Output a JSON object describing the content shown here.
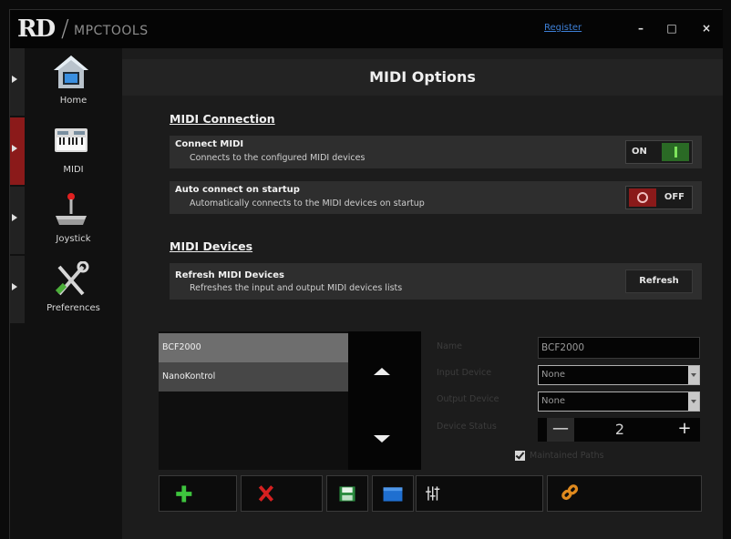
{
  "app": {
    "logo_text": "MPCTOOLS",
    "logo_mark": "RD",
    "register_label": "Register",
    "minimize_label": "–",
    "maximize_label": "□",
    "close_label": "×"
  },
  "sidebar": {
    "items": [
      {
        "label": "Home",
        "icon": "home-icon",
        "active": false
      },
      {
        "label": "MIDI",
        "icon": "midi-keyboard-icon",
        "active": true
      },
      {
        "label": "Joystick",
        "icon": "joystick-icon",
        "active": false
      },
      {
        "label": "Preferences",
        "icon": "tools-icon",
        "active": false
      }
    ]
  },
  "main": {
    "title": "MIDI Options",
    "midi_connection": {
      "heading": "MIDI Connection",
      "connect": {
        "title": "Connect MIDI",
        "description": "Connects to the configured MIDI devices",
        "state_label": "ON",
        "state": "on"
      },
      "auto_connect": {
        "title": "Auto connect on startup",
        "description": "Automatically connects to the MIDI devices on startup",
        "state_label": "OFF",
        "state": "off"
      }
    },
    "midi_devices": {
      "heading": "MIDI Devices",
      "refresh": {
        "title": "Refresh MIDI Devices",
        "description": "Refreshes the input and output MIDI devices lists",
        "button_label": "Refresh"
      },
      "devices": [
        "BCF2000",
        "NanoKontrol"
      ],
      "selected_device": "BCF2000"
    },
    "device_form": {
      "name_label": "Name",
      "name_value": "BCF2000",
      "input_label": "Input Device",
      "input_value": "None",
      "output_label": "Output Device",
      "output_value": "None",
      "status_label": "Device Status",
      "status_value": "2",
      "minus_label": "—",
      "plus_label": "+",
      "checkbox_checked": true,
      "checkbox_label": "Maintained Paths"
    },
    "toolbar": {
      "add_icon": "plus-icon",
      "delete_icon": "x-icon",
      "save_icon": "save-icon",
      "open_icon": "folder-icon",
      "mixer_icon": "sliders-icon",
      "link_icon": "link-icon"
    }
  },
  "colors": {
    "accent_red": "#8b1a1a",
    "toggle_on": "#2a6a25",
    "toggle_off": "#8a1a1a",
    "add_green": "#3ec43e",
    "delete_red": "#d62020",
    "link_orange": "#e08a1e",
    "folder_blue": "#1f6fd0",
    "register_blue": "#3d7fd6"
  }
}
